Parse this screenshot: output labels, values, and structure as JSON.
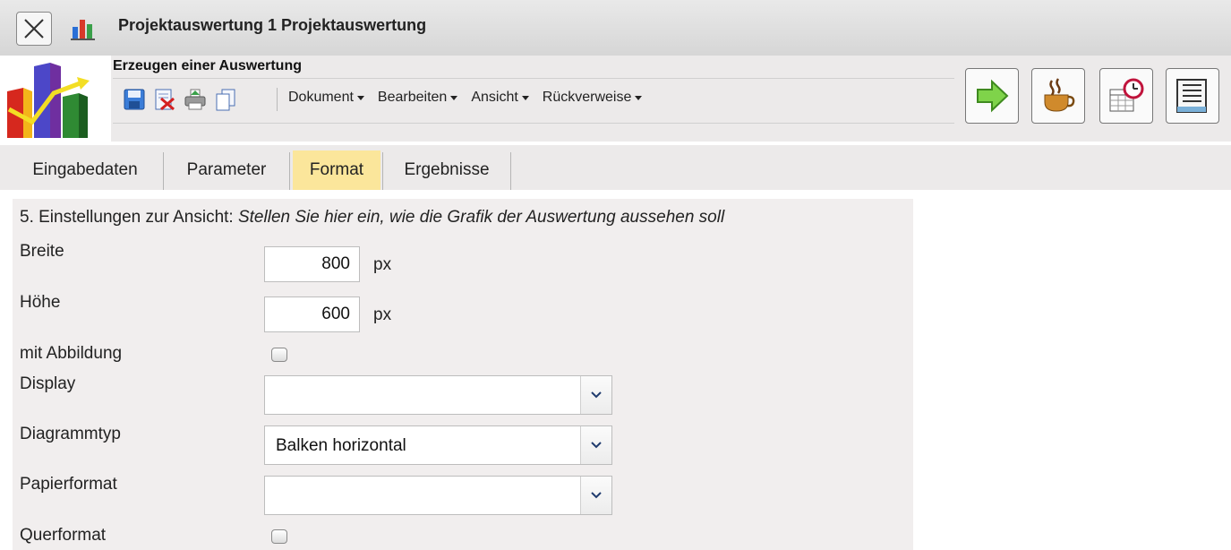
{
  "window": {
    "title": "Projektauswertung 1 Projektauswertung",
    "close_icon": "close-icon",
    "app_icon": "bar-chart-icon"
  },
  "header": {
    "section_title": "Erzeugen einer Auswertung",
    "toolbar_icons": [
      "save-icon",
      "delete-document-icon",
      "print-icon",
      "copy-icon"
    ],
    "menus": [
      {
        "label": "Dokument"
      },
      {
        "label": "Bearbeiten"
      },
      {
        "label": "Ansicht"
      },
      {
        "label": "Rückverweise"
      }
    ],
    "action_buttons": [
      "run-arrow-icon",
      "coffee-icon",
      "schedule-calendar-icon",
      "list-settings-icon"
    ]
  },
  "tabs": [
    {
      "label": "Eingabedaten",
      "active": false
    },
    {
      "label": "Parameter",
      "active": false
    },
    {
      "label": "Format",
      "active": true
    },
    {
      "label": "Ergebnisse",
      "active": false
    }
  ],
  "form": {
    "heading_prefix": "5. Einstellungen zur Ansicht: ",
    "heading_hint": "Stellen Sie hier ein, wie die Grafik der Auswertung aussehen soll",
    "width": {
      "label": "Breite",
      "value": "800",
      "unit": "px"
    },
    "height": {
      "label": "Höhe",
      "value": "600",
      "unit": "px"
    },
    "with_image": {
      "label": "mit Abbildung",
      "checked": false
    },
    "display": {
      "label": "Display",
      "value": ""
    },
    "chart_type": {
      "label": "Diagrammtyp",
      "value": "Balken horizontal"
    },
    "paper_format": {
      "label": "Papierformat",
      "value": ""
    },
    "landscape": {
      "label": "Querformat",
      "checked": false
    }
  },
  "colors": {
    "active_tab": "#fbe69b",
    "panel_bg": "#f1eeee",
    "toolbar_bg": "#eceaea"
  }
}
